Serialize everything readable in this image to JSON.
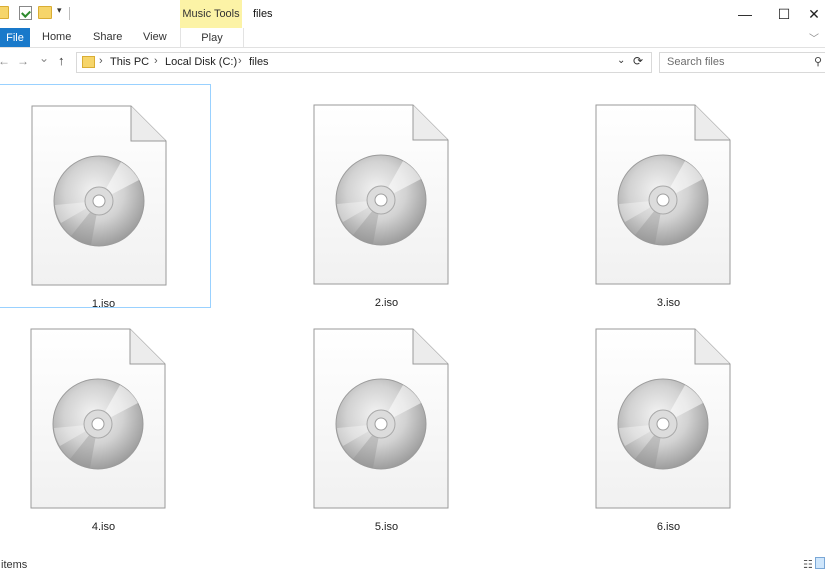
{
  "window": {
    "title": "files",
    "context_tab_group": "Music Tools",
    "minimize_glyph": "—",
    "maximize_glyph": "☐",
    "close_glyph": "✕"
  },
  "quick_access": {
    "dropdown_glyph": "▾"
  },
  "ribbon": {
    "tabs": [
      "File",
      "Home",
      "Share",
      "View"
    ],
    "context_tab": "Play",
    "collapse_glyph": "﹀",
    "file_tab_color": "#1979ca",
    "context_color": "#fcf3a6"
  },
  "navigation": {
    "back_glyph": "←",
    "forward_glyph": "→",
    "recent_glyph": "⌄",
    "up_glyph": "↑"
  },
  "address": {
    "breadcrumbs": [
      "This PC",
      "Local Disk (C:)",
      "files"
    ],
    "separator": "›",
    "dropdown_glyph": "⌄",
    "refresh_glyph": "⟳"
  },
  "search": {
    "placeholder": "Search files",
    "icon_glyph": "⚲"
  },
  "files": [
    {
      "name": "1.iso",
      "icon": "disc-image-file-icon",
      "selected": true
    },
    {
      "name": "2.iso",
      "icon": "disc-image-file-icon",
      "selected": false
    },
    {
      "name": "3.iso",
      "icon": "disc-image-file-icon",
      "selected": false
    },
    {
      "name": "4.iso",
      "icon": "disc-image-file-icon",
      "selected": false
    },
    {
      "name": "5.iso",
      "icon": "disc-image-file-icon",
      "selected": false
    },
    {
      "name": "6.iso",
      "icon": "disc-image-file-icon",
      "selected": false
    }
  ],
  "status": {
    "items_text": "items",
    "details_view_glyph": "☷",
    "selection_color": "#99d1ff"
  }
}
